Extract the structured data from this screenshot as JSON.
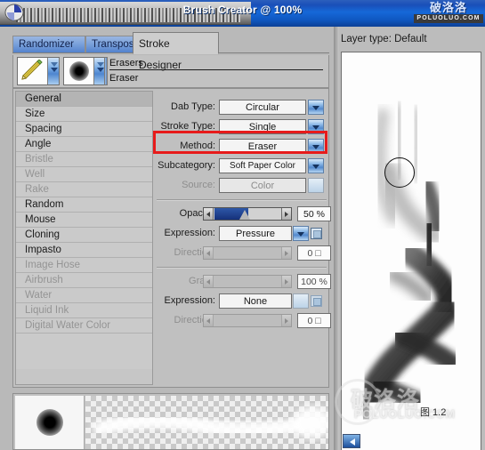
{
  "window": {
    "title": "Brush Creator @ 100%",
    "watermark_cn": "破洛洛",
    "watermark_en": "POLUOLUO.COM"
  },
  "tabs": [
    {
      "label": "Randomizer",
      "active": false
    },
    {
      "label": "Transposer",
      "active": false
    },
    {
      "label": "Stroke Designer",
      "active": true
    }
  ],
  "brush_bar": {
    "category": "Erasers",
    "variant": "Eraser",
    "brush_icon": "pencil-icon",
    "dab_icon": "dab-dot-icon"
  },
  "nav": {
    "items": [
      {
        "label": "General",
        "state": "selected"
      },
      {
        "label": "Size",
        "state": "enabled"
      },
      {
        "label": "Spacing",
        "state": "enabled"
      },
      {
        "label": "Angle",
        "state": "enabled"
      },
      {
        "label": "Bristle",
        "state": "disabled"
      },
      {
        "label": "Well",
        "state": "disabled"
      },
      {
        "label": "Rake",
        "state": "disabled"
      },
      {
        "label": "Random",
        "state": "enabled"
      },
      {
        "label": "Mouse",
        "state": "enabled"
      },
      {
        "label": "Cloning",
        "state": "enabled"
      },
      {
        "label": "Impasto",
        "state": "enabled"
      },
      {
        "label": "Image Hose",
        "state": "disabled"
      },
      {
        "label": "Airbrush",
        "state": "disabled"
      },
      {
        "label": "Water",
        "state": "disabled"
      },
      {
        "label": "Liquid Ink",
        "state": "disabled"
      },
      {
        "label": "Digital Water Color",
        "state": "disabled"
      }
    ]
  },
  "settings": {
    "dab_type": {
      "label": "Dab Type:",
      "value": "Circular",
      "enabled": true
    },
    "stroke_type": {
      "label": "Stroke Type:",
      "value": "Single",
      "enabled": true
    },
    "method": {
      "label": "Method:",
      "value": "Eraser",
      "enabled": true,
      "highlighted": true
    },
    "subcategory": {
      "label": "Subcategory:",
      "value": "Soft Paper Color",
      "enabled": true
    },
    "source": {
      "label": "Source:",
      "value": "Color",
      "enabled": false
    },
    "opacity": {
      "label": "Opacity:",
      "value": "50 %",
      "percent": 50,
      "enabled": true
    },
    "opacity_expr": {
      "label": "Expression:",
      "value": "Pressure",
      "enabled": true,
      "checkbox": true
    },
    "opacity_dir": {
      "label": "Direction:",
      "value": "0 □",
      "percent": 0,
      "enabled": false
    },
    "grain": {
      "label": "Grain:",
      "value": "100 %",
      "percent": 100,
      "enabled": false
    },
    "grain_expr": {
      "label": "Expression:",
      "value": "None",
      "enabled": false
    },
    "grain_dir": {
      "label": "Direction:",
      "value": "0 □",
      "percent": 0,
      "enabled": false
    }
  },
  "preview": {
    "layer_type": "Layer type: Default",
    "zoom_label": "图 1.2"
  },
  "colors": {
    "accent_blue": "#1668d8",
    "highlight_red": "#e71b1b",
    "panel_gray": "#c0c0c0",
    "slider_fill": "#2e58a8"
  }
}
